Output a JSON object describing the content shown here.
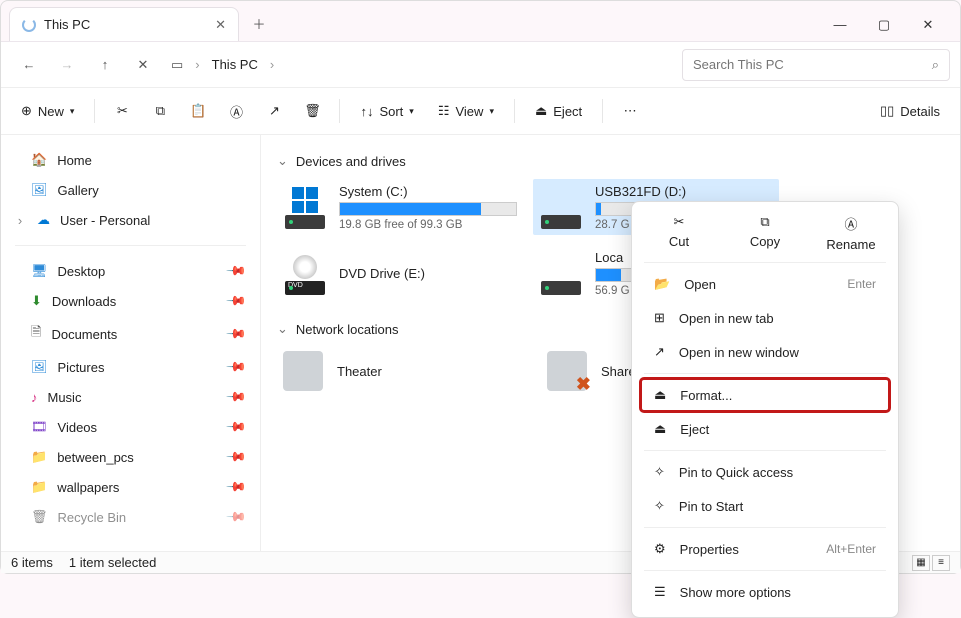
{
  "tab": {
    "title": "This PC"
  },
  "window_buttons": {
    "min": "—",
    "max": "▢",
    "close": "✕"
  },
  "nav": {
    "back": "←",
    "forward": "→",
    "up": "↑",
    "refresh": "✕"
  },
  "breadcrumb": {
    "root_glyph": "🖥",
    "item": "This PC"
  },
  "search": {
    "placeholder": "Search This PC"
  },
  "toolbar": {
    "new": "New",
    "sort": "Sort",
    "view": "View",
    "eject": "Eject",
    "details": "Details"
  },
  "sidebar": {
    "home": "Home",
    "gallery": "Gallery",
    "user": "User - Personal",
    "desktop": "Desktop",
    "downloads": "Downloads",
    "documents": "Documents",
    "pictures": "Pictures",
    "music": "Music",
    "videos": "Videos",
    "between": "between_pcs",
    "wallpapers": "wallpapers",
    "recycle": "Recycle Bin"
  },
  "sections": {
    "devices": "Devices and drives",
    "network": "Network locations"
  },
  "drives": [
    {
      "name": "System (C:)",
      "free": "19.8 GB free of 99.3 GB",
      "fill_pct": 80
    },
    {
      "name": "USB321FD (D:)",
      "free": "28.7 G",
      "fill_pct": 3,
      "selected": true
    },
    {
      "name": "DVD Drive (E:)"
    },
    {
      "name": "Loca",
      "free": "56.9 G",
      "fill_pct": 14
    }
  ],
  "network": [
    {
      "name": "Theater"
    },
    {
      "name": "Share",
      "blocked": true
    }
  ],
  "context": {
    "actions": {
      "cut": "Cut",
      "copy": "Copy",
      "rename": "Rename"
    },
    "items": [
      {
        "label": "Open",
        "shortcut": "Enter",
        "icon": "open"
      },
      {
        "label": "Open in new tab",
        "icon": "tab"
      },
      {
        "label": "Open in new window",
        "icon": "window"
      },
      {
        "label": "Format...",
        "icon": "format",
        "highlight": true
      },
      {
        "label": "Eject",
        "icon": "eject"
      },
      {
        "label": "Pin to Quick access",
        "icon": "pin"
      },
      {
        "label": "Pin to Start",
        "icon": "pin"
      },
      {
        "label": "Properties",
        "shortcut": "Alt+Enter",
        "icon": "props"
      },
      {
        "label": "Show more options",
        "icon": "more"
      }
    ]
  },
  "status": {
    "count": "6 items",
    "selected": "1 item selected"
  }
}
